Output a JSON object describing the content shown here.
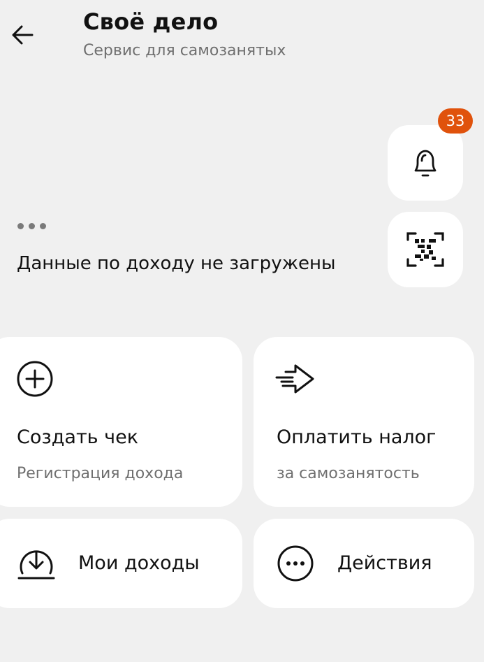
{
  "header": {
    "title": "Своё дело",
    "subtitle": "Сервис для самозанятых"
  },
  "notifications": {
    "badge_count": "33",
    "badge_color": "#e0520c"
  },
  "income": {
    "status_text": "Данные по доходу не загружены"
  },
  "actions": [
    {
      "title": "Создать чек",
      "subtitle": "Регистрация дохода",
      "icon": "plus-circle-icon"
    },
    {
      "title": "Оплатить налог",
      "subtitle": "за самозанятость",
      "icon": "arrow-send-icon"
    },
    {
      "title": "Мои доходы",
      "icon": "download-circle-icon"
    },
    {
      "title": "Действия",
      "icon": "more-dots-circle-icon"
    }
  ],
  "colors": {
    "background": "#f0f0f0",
    "card": "#ffffff",
    "text_primary": "#111111",
    "text_secondary": "#6f6f6f"
  }
}
